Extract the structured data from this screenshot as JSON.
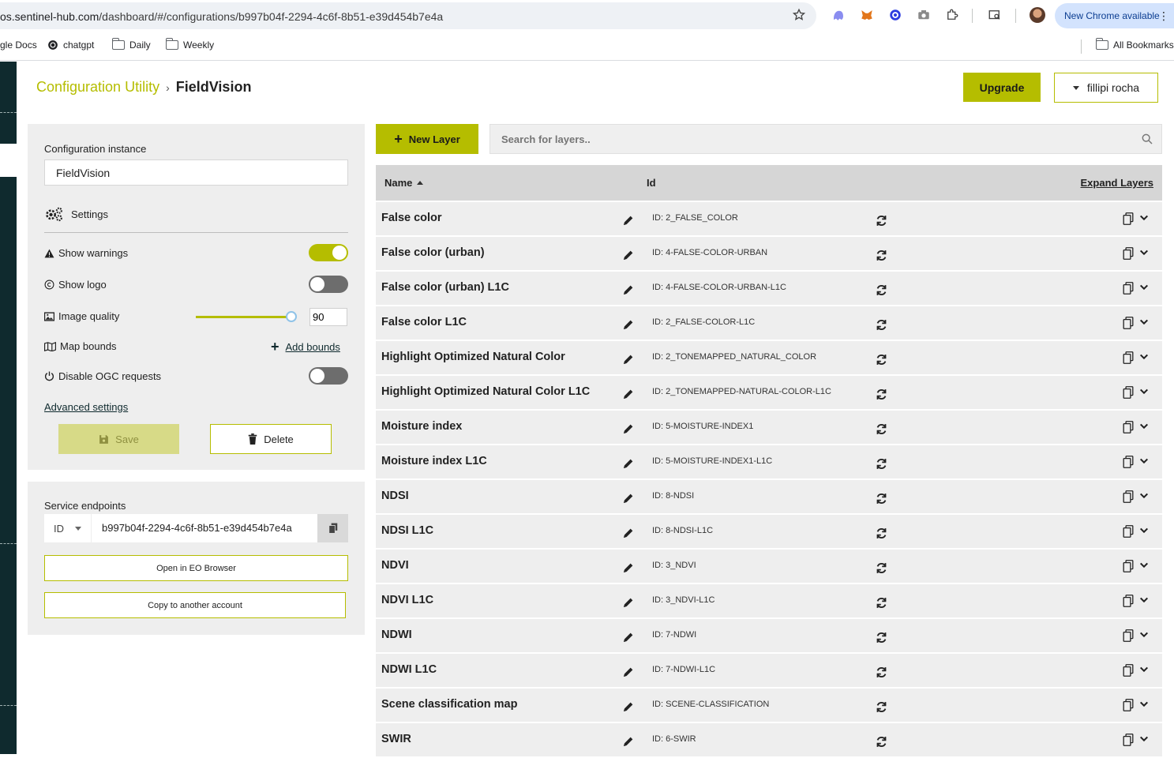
{
  "browser": {
    "url_host": "os.sentinel-hub.com",
    "url_path": "/dashboard/#/configurations/b997b04f-2294-4c6f-8b51-e39d454b7e4a",
    "new_chrome": "New Chrome available"
  },
  "bookmarks": {
    "items": [
      "gle Docs",
      "chatgpt",
      "Daily",
      "Weekly"
    ],
    "all": "All Bookmarks"
  },
  "header": {
    "breadcrumb_root": "Configuration Utility",
    "breadcrumb_current": "FieldVision",
    "upgrade": "Upgrade",
    "user": "fillipi rocha"
  },
  "config": {
    "instance_label": "Configuration instance",
    "instance_value": "FieldVision",
    "settings": "Settings",
    "show_warnings": "Show warnings",
    "show_warnings_on": true,
    "show_logo": "Show logo",
    "show_logo_on": false,
    "image_quality": "Image quality",
    "image_quality_value": "90",
    "map_bounds": "Map bounds",
    "add_bounds": "Add bounds",
    "disable_ogc": "Disable OGC requests",
    "disable_ogc_on": false,
    "advanced": "Advanced settings",
    "save": "Save",
    "delete": "Delete"
  },
  "endpoints": {
    "title": "Service endpoints",
    "select": "ID",
    "value": "b997b04f-2294-4c6f-8b51-e39d454b7e4a",
    "open_eo": "Open in EO Browser",
    "copy_account": "Copy to another account"
  },
  "layers": {
    "new_layer": "New Layer",
    "search_placeholder": "Search for layers..",
    "col_name": "Name",
    "col_id": "Id",
    "expand": "Expand Layers",
    "rows": [
      {
        "name": "False color",
        "id": "ID: 2_FALSE_COLOR"
      },
      {
        "name": "False color (urban)",
        "id": "ID: 4-FALSE-COLOR-URBAN"
      },
      {
        "name": "False color (urban) L1C",
        "id": "ID: 4-FALSE-COLOR-URBAN-L1C"
      },
      {
        "name": "False color L1C",
        "id": "ID: 2_FALSE-COLOR-L1C"
      },
      {
        "name": "Highlight Optimized Natural Color",
        "id": "ID: 2_TONEMAPPED_NATURAL_COLOR"
      },
      {
        "name": "Highlight Optimized Natural Color L1C",
        "id": "ID: 2_TONEMAPPED-NATURAL-COLOR-L1C"
      },
      {
        "name": "Moisture index",
        "id": "ID: 5-MOISTURE-INDEX1"
      },
      {
        "name": "Moisture index L1C",
        "id": "ID: 5-MOISTURE-INDEX1-L1C"
      },
      {
        "name": "NDSI",
        "id": "ID: 8-NDSI"
      },
      {
        "name": "NDSI L1C",
        "id": "ID: 8-NDSI-L1C"
      },
      {
        "name": "NDVI",
        "id": "ID: 3_NDVI"
      },
      {
        "name": "NDVI L1C",
        "id": "ID: 3_NDVI-L1C"
      },
      {
        "name": "NDWI",
        "id": "ID: 7-NDWI"
      },
      {
        "name": "NDWI L1C",
        "id": "ID: 7-NDWI-L1C"
      },
      {
        "name": "Scene classification map",
        "id": "ID: SCENE-CLASSIFICATION"
      },
      {
        "name": "SWIR",
        "id": "ID: 6-SWIR"
      }
    ]
  },
  "colors": {
    "accent": "#b5bd00",
    "dark": "#0f2a2e",
    "panel": "#eeeeee"
  }
}
